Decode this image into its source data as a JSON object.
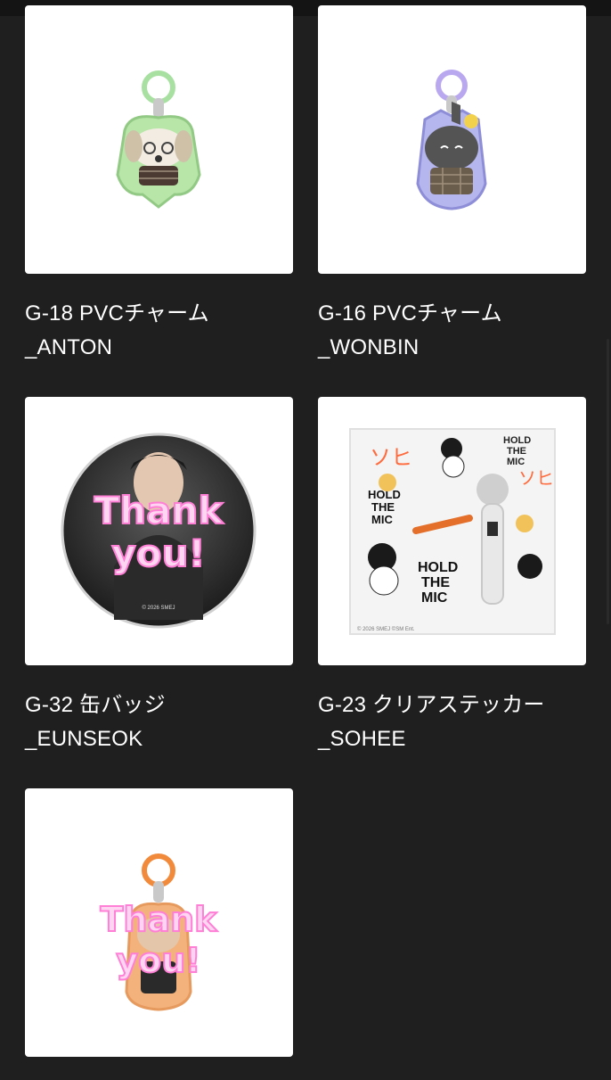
{
  "products": [
    {
      "code_name": "G-18 PVCチャーム",
      "member": "_ANTON",
      "image_icon": "green-dog-charm-icon"
    },
    {
      "code_name": "G-16 PVCチャーム",
      "member": "_WONBIN",
      "image_icon": "purple-cat-charm-icon"
    },
    {
      "code_name": "G-32 缶バッジ",
      "member": "_EUNSEOK",
      "image_icon": "can-badge-icon"
    },
    {
      "code_name": "G-23 クリアステッカー",
      "member": "_SOHEE",
      "image_icon": "clear-sticker-sheet-icon"
    },
    {
      "code_name": "",
      "member": "",
      "image_icon": "orange-charm-icon"
    }
  ],
  "badge_text": {
    "line1": "Thank",
    "line2": "you!"
  },
  "sticker_text": {
    "hold1": "HOLD",
    "hold2": "THE",
    "hold3": "MIC",
    "copyright": "© 2026 SMEJ ©SM Ent."
  },
  "badge_copyright": "© 2026 SMEJ",
  "charm_copyright": "© 2026 SMEJ",
  "colors": {
    "background": "#1f1f1f",
    "card": "#ffffff",
    "text": "#ffffff",
    "green": "#9ed58b",
    "purple": "#b7a6ef",
    "orange": "#f28a3c",
    "pink_glow": "#ff7fd6"
  }
}
